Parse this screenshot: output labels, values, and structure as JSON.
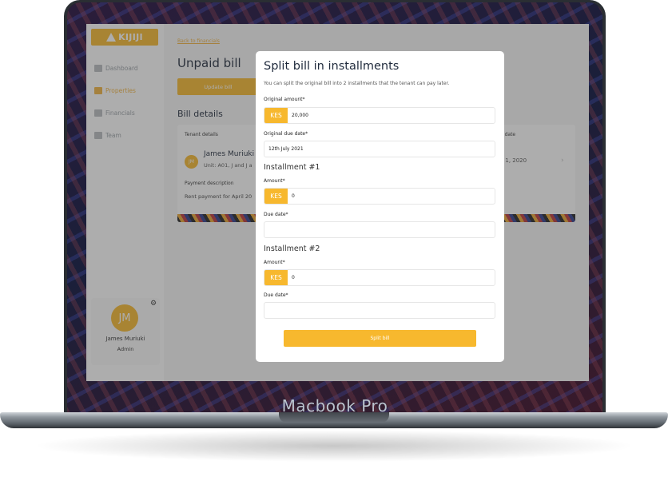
{
  "device": {
    "label": "Macbook Pro"
  },
  "sidebar": {
    "logo_text": "KIJIJI",
    "items": [
      {
        "label": "Dashboard",
        "icon": "dashboard-icon"
      },
      {
        "label": "Properties",
        "icon": "building-icon",
        "active": true
      },
      {
        "label": "Financials",
        "icon": "wallet-icon"
      },
      {
        "label": "Team",
        "icon": "team-icon"
      }
    ],
    "profile": {
      "initials": "JM",
      "name": "James Muriuki",
      "role": "Admin"
    }
  },
  "main": {
    "back_link": "Back to financials",
    "page_title": "Unpaid bill",
    "update_button": "Update bill",
    "bill_details_title": "Bill details",
    "bill": {
      "tenant_details_label": "Tenant details",
      "due_date_label": "e date",
      "tenant_initials": "JM",
      "tenant_name": "James Muriuki",
      "unit": "Unit: A01, J and J a",
      "due_date": "y 1, 2020",
      "payment_description_label": "Payment description",
      "payment_description": "Rent payment for April 20"
    }
  },
  "modal": {
    "title": "Split bill in installments",
    "subtitle": "You can split the original bill into 2 installments that the tenant can pay later.",
    "original_amount_label": "Original amount*",
    "currency": "KES",
    "original_amount": "20,000",
    "original_due_date_label": "Original due date*",
    "original_due_date": "12th July 2021",
    "installments": [
      {
        "title": "Installment #1",
        "amount_label": "Amount*",
        "amount": "0",
        "due_date_label": "Due date*",
        "due_date": ""
      },
      {
        "title": "Installment #2",
        "amount_label": "Amount*",
        "amount": "0",
        "due_date_label": "Due date*",
        "due_date": ""
      }
    ],
    "submit_label": "Split bill"
  },
  "colors": {
    "accent": "#f7b82e",
    "title": "#1f2a3c"
  }
}
